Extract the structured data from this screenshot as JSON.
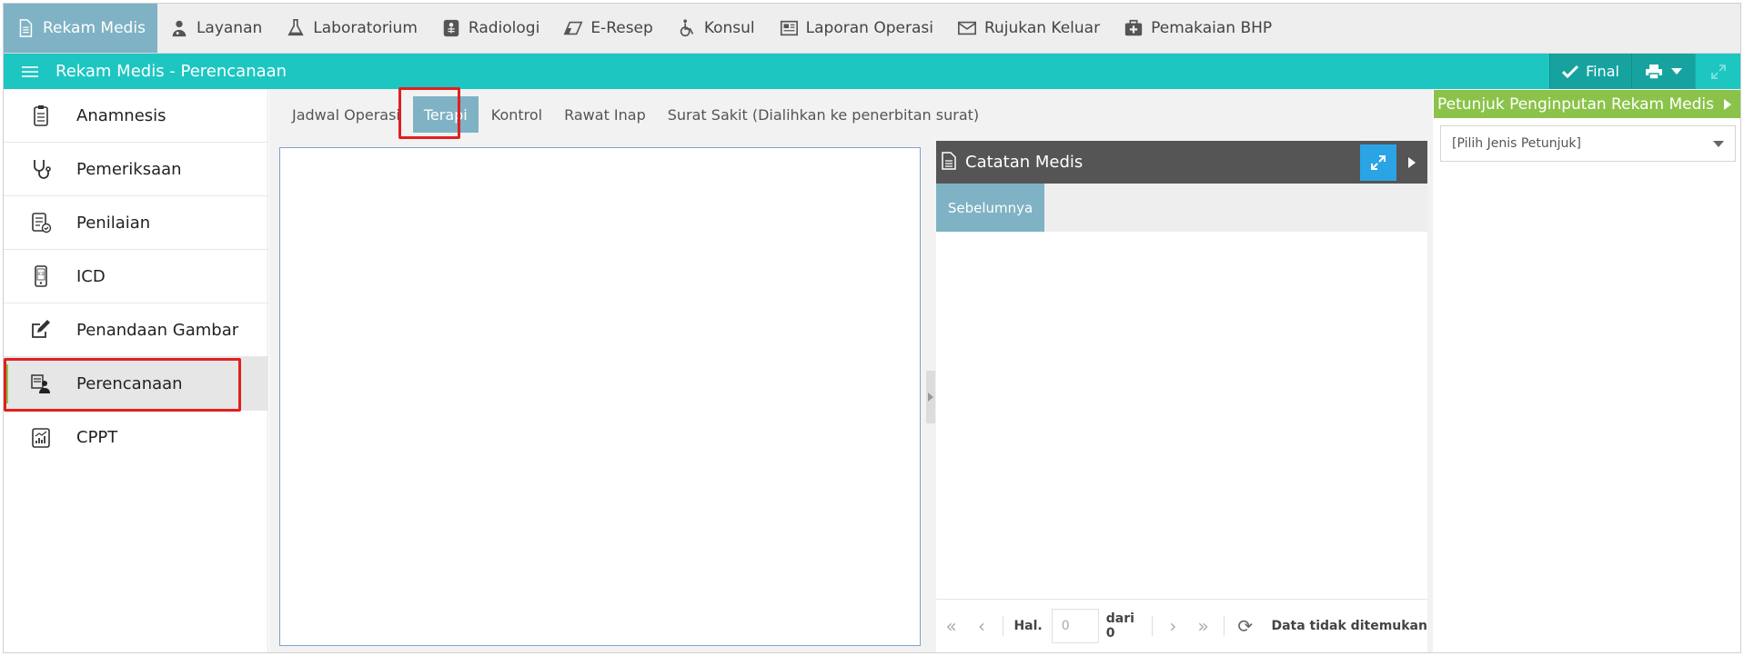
{
  "topnav": {
    "items": [
      {
        "label": "Rekam Medis",
        "icon": "document-icon",
        "active": true
      },
      {
        "label": "Layanan",
        "icon": "doctor-icon"
      },
      {
        "label": "Laboratorium",
        "icon": "flask-icon"
      },
      {
        "label": "Radiologi",
        "icon": "xray-icon"
      },
      {
        "label": "E-Resep",
        "icon": "eraser-icon"
      },
      {
        "label": "Konsul",
        "icon": "wheelchair-icon"
      },
      {
        "label": "Laporan Operasi",
        "icon": "newspaper-icon"
      },
      {
        "label": "Rujukan Keluar",
        "icon": "envelope-icon"
      },
      {
        "label": "Pemakaian BHP",
        "icon": "medkit-icon"
      }
    ]
  },
  "titlebar": {
    "title": "Rekam Medis - Perencanaan",
    "final_label": "Final"
  },
  "sidebar": {
    "items": [
      {
        "label": "Anamnesis",
        "icon": "clipboard-icon"
      },
      {
        "label": "Pemeriksaan",
        "icon": "stethoscope-icon"
      },
      {
        "label": "Penilaian",
        "icon": "checklist-icon"
      },
      {
        "label": "ICD",
        "icon": "icd-phone-icon"
      },
      {
        "label": "Penandaan Gambar",
        "icon": "edit-icon"
      },
      {
        "label": "Perencanaan",
        "icon": "planning-icon",
        "active": true
      },
      {
        "label": "CPPT",
        "icon": "chart-icon"
      }
    ]
  },
  "subtabs": [
    {
      "label": "Jadwal Operasi"
    },
    {
      "label": "Terapi",
      "active": true
    },
    {
      "label": "Kontrol"
    },
    {
      "label": "Rawat Inap"
    },
    {
      "label": "Surat Sakit (Dialihkan ke penerbitan surat)"
    }
  ],
  "catatan_medis": {
    "title": "Catatan Medis",
    "tab_label": "Sebelumnya",
    "pager": {
      "page_label": "Hal.",
      "page_value": "0",
      "of_label": "dari 0",
      "info": "Data tidak ditemukan"
    }
  },
  "right_panel": {
    "title": "Petunjuk Penginputan Rekam Medis",
    "select_value": "[Pilih Jenis Petunjuk]"
  },
  "colors": {
    "teal": "#1dc6c1",
    "active_tab": "#7fb2c4",
    "green": "#8bc34a",
    "highlight": "#e02020",
    "expand_blue": "#2ba4e6"
  }
}
